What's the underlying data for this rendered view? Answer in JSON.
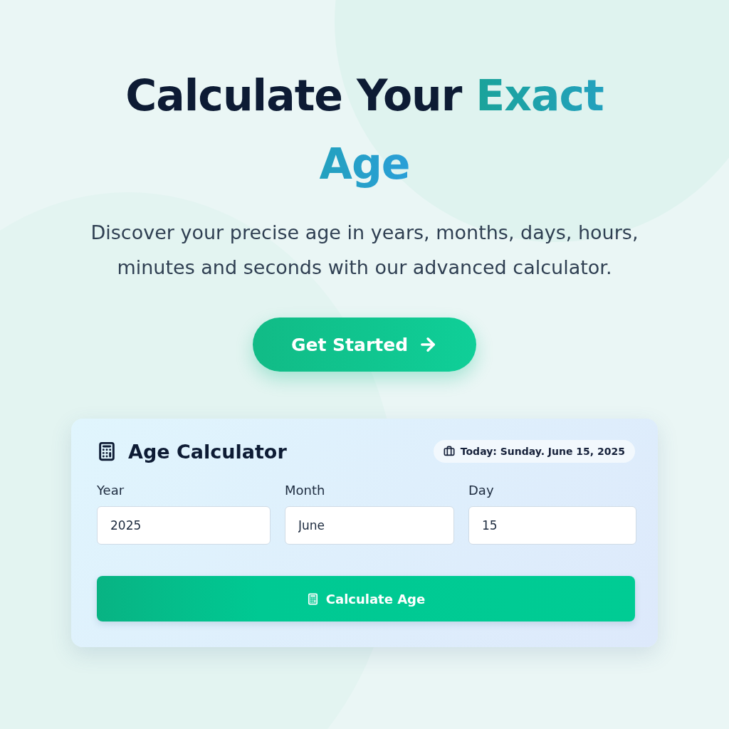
{
  "hero": {
    "title_parts": [
      {
        "text": "Calculate Your ",
        "accent": false
      },
      {
        "text": "Exact Age",
        "accent": true
      }
    ],
    "subtitle": "Discover your precise age in years, months, days, hours, minutes and seconds with our advanced calculator.",
    "cta": "Get Started"
  },
  "calculator": {
    "title": "Age Calculator",
    "today": "Today: Sunday. June 15, 2025",
    "fields": [
      {
        "label": "Year",
        "value": "2025"
      },
      {
        "label": "Month",
        "value": "June"
      },
      {
        "label": "Day",
        "value": "15"
      }
    ],
    "button": "Calculate Age"
  }
}
